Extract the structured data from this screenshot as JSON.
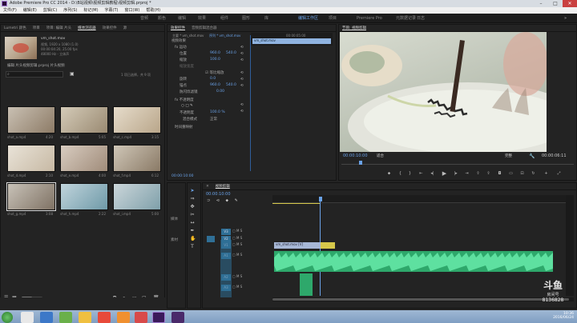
{
  "window": {
    "title": "Adobe Premiere Pro CC 2014 - D:\\B站视频\\视频剪辑教程\\视频剪辑.prproj *"
  },
  "menu": [
    "文件(F)",
    "编辑(E)",
    "剪辑(C)",
    "序列(S)",
    "标记(M)",
    "字幕(T)",
    "窗口(W)",
    "帮助(H)"
  ],
  "workspaces": [
    "音频",
    "颜色",
    "编辑",
    "效果",
    "组件",
    "图形",
    "库",
    "Premiere Pro",
    "元数据记录",
    "编辑工作区",
    "项目",
    "SpeedGrade",
    "分析",
    "日志"
  ],
  "project": {
    "tabs": [
      "Lumetri 颜色",
      "项目",
      "项目: 编辑 片头",
      "媒体浏览器",
      "效果控件",
      "源"
    ],
    "clip_name": "vm_shot.mov",
    "clip_info": [
      "视频, 1920 x 1080 (1.0)",
      "00:00:04:20, 25.00 fps",
      "48000 Hz - 立体声"
    ],
    "path": "编辑 片头视频剪辑.prproj 片头视频",
    "search_placeholder": "",
    "count": "1 项已选择，共 9 项",
    "items": [
      {
        "name": "shot_a.mp4",
        "dur": "4:20"
      },
      {
        "name": "shot_b.mp4",
        "dur": "5:05"
      },
      {
        "name": "shot_c.mp4",
        "dur": "3:15"
      },
      {
        "name": "shot_d.mp4",
        "dur": "2:10"
      },
      {
        "name": "shot_e.mp4",
        "dur": "4:00"
      },
      {
        "name": "shot_f.mp4",
        "dur": "6:12"
      },
      {
        "name": "shot_g.mp4",
        "dur": "3:08"
      },
      {
        "name": "shot_h.mp4",
        "dur": "2:22"
      },
      {
        "name": "shot_i.mp4",
        "dur": "5:00"
      }
    ]
  },
  "effects": {
    "tabs": [
      "效果控件",
      "音频剪辑混合器"
    ],
    "source": "主要 * vm_shot.mov",
    "seq": "序列 * vm_shot.mov",
    "time": "00:00:05:00",
    "clip": "vm_shot.mov",
    "video_fx": "视频效果",
    "motion": "fx 运动",
    "position": "位置",
    "pos_x": "960.0",
    "pos_y": "540.0",
    "scale": "缩放",
    "scale_v": "100.0",
    "scale_w": "缩放宽度",
    "uniform": "等比缩放",
    "rotation": "旋转",
    "rotation_v": "0.0",
    "anchor": "锚点",
    "anchor_x": "960.0",
    "anchor_y": "540.0",
    "flicker": "防闪烁滤镜",
    "flicker_v": "0.00",
    "opacity": "fx 不透明度",
    "opacity_label": "不透明度",
    "opacity_v": "100.0 %",
    "blend": "混合模式",
    "blend_v": "正常",
    "time_remap": "时间重映射",
    "bottom_time": "00:00:10:00"
  },
  "program": {
    "title": "节目: 视频剪辑",
    "timecode": "00:00:10:00",
    "fit": "适合",
    "quality": "完整",
    "duration": "00:00:06:11"
  },
  "timeline": {
    "tab": "视频剪辑",
    "timecode": "00:00:10:00",
    "tracks": [
      {
        "name": "V3"
      },
      {
        "name": "V2"
      },
      {
        "name": "V1"
      },
      {
        "name": "A1"
      },
      {
        "name": "A2"
      },
      {
        "name": "A3"
      }
    ],
    "video_clip_label": "vm_shot.mov [V]",
    "left_labels": [
      "媒体",
      "素材"
    ]
  },
  "taskbar": {
    "clock": "10:36",
    "date": "2016/06/24"
  },
  "watermark": {
    "name": "斗鱼",
    "sub": "房间号",
    "room": "8136828"
  }
}
